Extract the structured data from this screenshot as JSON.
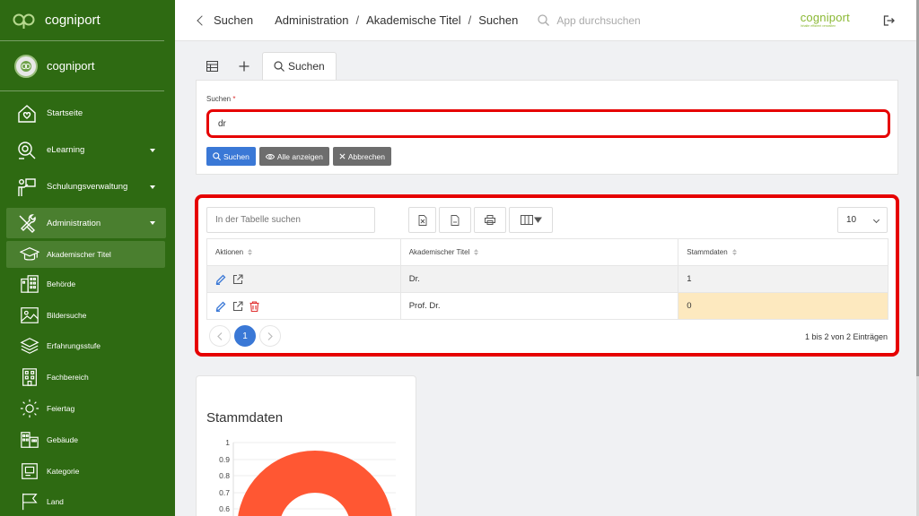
{
  "sidebar": {
    "brand": "cogniport",
    "user": "cogniport",
    "items": [
      {
        "label": "Startseite",
        "icon": "home-icon"
      },
      {
        "label": "eLearning",
        "icon": "elearning-icon"
      },
      {
        "label": "Schulungsverwaltung",
        "icon": "training-icon"
      },
      {
        "label": "Administration",
        "icon": "tools-icon"
      }
    ],
    "sub_items": [
      {
        "label": "Akademischer Titel",
        "icon": "graduation-cap-icon"
      },
      {
        "label": "Behörde",
        "icon": "building-icon"
      },
      {
        "label": "Bildersuche",
        "icon": "image-icon"
      },
      {
        "label": "Erfahrungsstufe",
        "icon": "layers-icon"
      },
      {
        "label": "Fachbereich",
        "icon": "office-icon"
      },
      {
        "label": "Feiertag",
        "icon": "sun-icon"
      },
      {
        "label": "Gebäude",
        "icon": "buildings-icon"
      },
      {
        "label": "Kategorie",
        "icon": "category-icon"
      },
      {
        "label": "Land",
        "icon": "flag-icon"
      }
    ]
  },
  "header": {
    "back_label": "Suchen",
    "breadcrumb": [
      "Administration",
      "Akademische Titel",
      "Suchen"
    ],
    "search_placeholder": "App durchsuchen",
    "logo_word": "cogniport",
    "logo_tag": "Inhalte effizient verwalten"
  },
  "tabs": {
    "search_label": "Suchen"
  },
  "search_form": {
    "label": "Suchen",
    "required_mark": "*",
    "value": "dr",
    "btn_search": "Suchen",
    "btn_show_all": "Alle anzeigen",
    "btn_cancel": "Abbrechen"
  },
  "table": {
    "search_placeholder": "In der Tabelle suchen",
    "page_size": "10",
    "columns": [
      "Aktionen",
      "Akademischer Titel",
      "Stammdaten"
    ],
    "rows": [
      {
        "title": "Dr.",
        "stammdaten": "1"
      },
      {
        "title": "Prof. Dr.",
        "stammdaten": "0"
      }
    ],
    "current_page": "1",
    "info": "1 bis 2 von 2 Einträgen"
  },
  "chart": {
    "title": "Stammdaten",
    "y_ticks": [
      "1",
      "0.9",
      "0.8",
      "0.7",
      "0.6"
    ],
    "color": "#ff5733"
  },
  "colors": {
    "sidebar": "#2e6a12",
    "primary": "#3a78d6",
    "highlight": "#e60000"
  }
}
